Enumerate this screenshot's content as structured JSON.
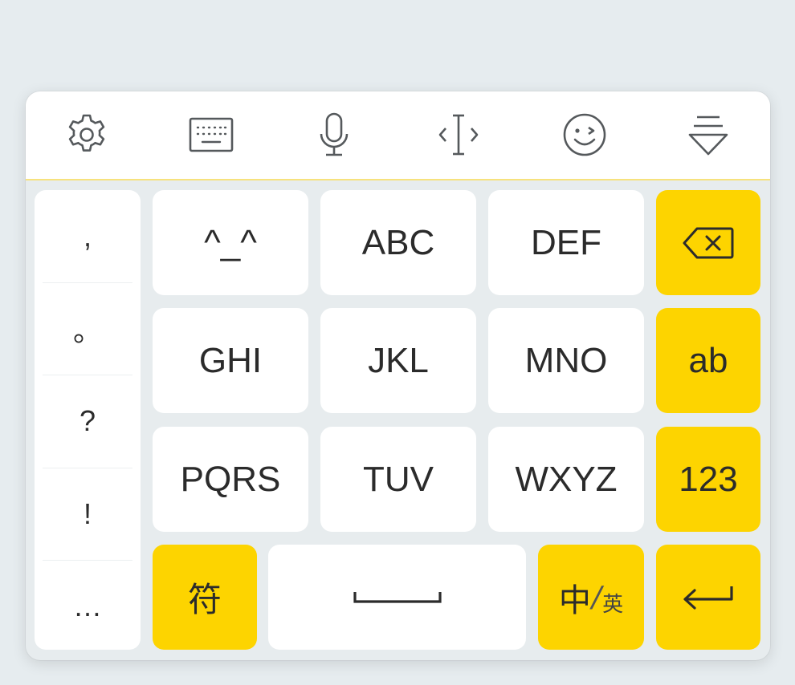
{
  "toolbar": {
    "icons": [
      "settings-icon",
      "keyboard-icon",
      "microphone-icon",
      "cursor-icon",
      "emoji-icon",
      "hide-keyboard-icon"
    ]
  },
  "punctuation": [
    ",",
    "。",
    "?",
    "!",
    "…"
  ],
  "keys": {
    "emoticon": "^_^",
    "abc": "ABC",
    "def": "DEF",
    "ghi": "GHI",
    "jkl": "JKL",
    "mno": "MNO",
    "pqrs": "PQRS",
    "tuv": "TUV",
    "wxyz": "WXYZ",
    "letters": "ab",
    "numbers": "123",
    "symbols": "符",
    "lang_main": "中",
    "lang_sep": "/",
    "lang_alt": "英"
  },
  "colors": {
    "accent": "#fdd400",
    "key_bg": "#ffffff",
    "panel_bg": "#e7ecee",
    "text": "#2b2b2b",
    "icon": "#55595c"
  }
}
